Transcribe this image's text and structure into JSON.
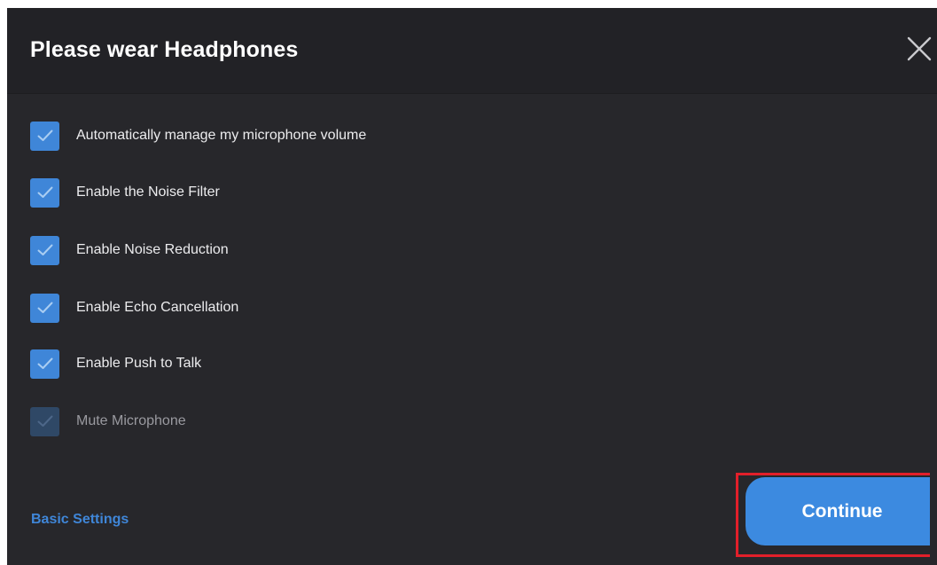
{
  "dialog": {
    "title": "Please wear Headphones"
  },
  "options": [
    {
      "label": "Automatically manage my microphone volume",
      "checked": true,
      "disabled": false
    },
    {
      "label": "Enable the Noise Filter",
      "checked": true,
      "disabled": false
    },
    {
      "label": "Enable Noise Reduction",
      "checked": true,
      "disabled": false
    },
    {
      "label": "Enable Echo Cancellation",
      "checked": true,
      "disabled": false
    },
    {
      "label": "Enable Push to Talk",
      "checked": true,
      "disabled": false
    },
    {
      "label": "Mute Microphone",
      "checked": true,
      "disabled": true
    }
  ],
  "footer": {
    "basic_settings_label": "Basic Settings",
    "continue_label": "Continue"
  },
  "icons": {
    "close": "close-icon",
    "check": "checkmark-icon"
  },
  "colors": {
    "accent": "#3f86d8",
    "highlight": "#e21f2a"
  }
}
